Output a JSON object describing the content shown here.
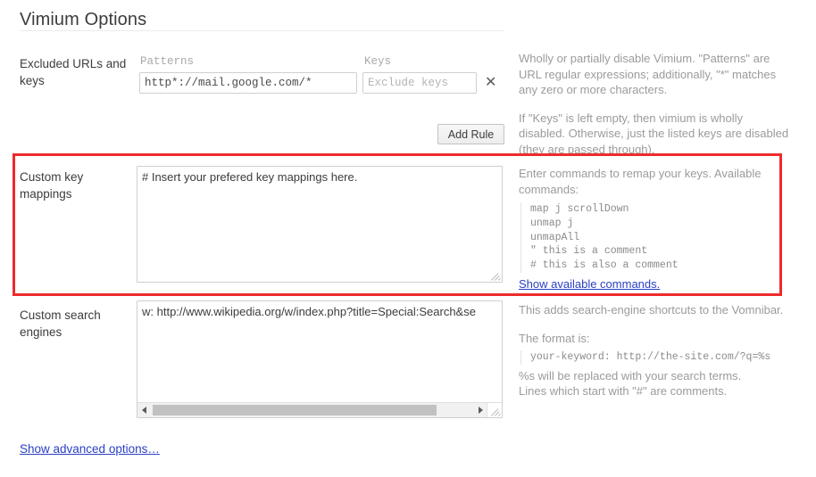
{
  "page": {
    "title": "Vimium Options"
  },
  "rows": {
    "excluded": {
      "label": "Excluded URLs and keys",
      "patterns_caption": "Patterns",
      "keys_caption": "Keys",
      "pattern_value": "http*://mail.google.com/*",
      "keys_value": "",
      "keys_placeholder": "Exclude keys",
      "remove_glyph": "✕",
      "add_rule_label": "Add Rule",
      "help_p1": "Wholly or partially disable Vimium. \"Patterns\" are URL regular expressions; additionally, \"*\" matches any zero or more characters.",
      "help_p2": "If \"Keys\" is left empty, then vimium is wholly disabled. Otherwise, just the listed keys are disabled (they are passed through)."
    },
    "key_mappings": {
      "label": "Custom key mappings",
      "value": "# Insert your prefered key mappings here.",
      "help_intro": "Enter commands to remap your keys. Available commands:",
      "help_code": "map j scrollDown\nunmap j\nunmapAll\n\" this is a comment\n# this is also a comment",
      "help_link": "Show available commands."
    },
    "search_engines": {
      "label": "Custom search engines",
      "value": "w: http://www.wikipedia.org/w/index.php?title=Special:Search&se",
      "help_p1": "This adds search-engine shortcuts to the Vomnibar.",
      "help_p2": "The format is:",
      "help_code": "your-keyword: http://the-site.com/?q=%s",
      "help_p3": "%s will be replaced with your search terms.",
      "help_p4": "Lines which start with \"#\" are comments.",
      "scroll_left_glyph": "◀",
      "scroll_right_glyph": "▶"
    }
  },
  "footer": {
    "advanced_link": "Show advanced options…"
  },
  "highlight": {
    "color": "#ee2b2b"
  }
}
